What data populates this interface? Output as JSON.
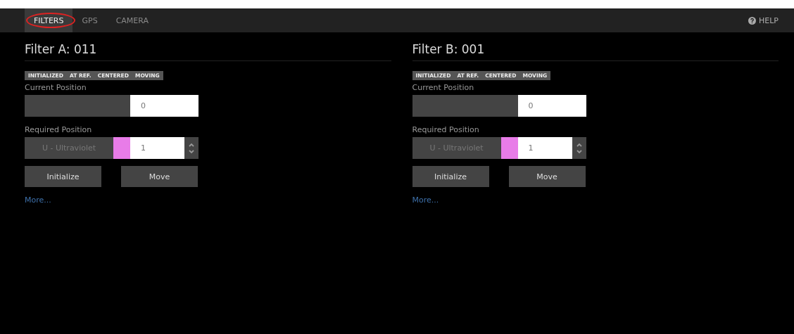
{
  "nav": {
    "tabs": [
      {
        "label": "FILTERS",
        "selected": true
      },
      {
        "label": "GPS",
        "selected": false
      },
      {
        "label": "CAMERA",
        "selected": false
      }
    ],
    "help": "HELP"
  },
  "filters": [
    {
      "title": "Filter A: 011",
      "statuses": [
        "INITIALIZED",
        "AT REF.",
        "CENTERED",
        "MOVING"
      ],
      "current_label": "Current Position",
      "current_value": "0",
      "required_label": "Required Position",
      "filter_name": "U - Ultraviolet",
      "color": "#e87ce8",
      "required_value": "1",
      "buttons": [
        "Initialize",
        "Move"
      ],
      "more": "More..."
    },
    {
      "title": "Filter B: 001",
      "statuses": [
        "INITIALIZED",
        "AT REF.",
        "CENTERED",
        "MOVING"
      ],
      "current_label": "Current Position",
      "current_value": "0",
      "required_label": "Required Position",
      "filter_name": "U - Ultraviolet",
      "color": "#e87ce8",
      "required_value": "1",
      "buttons": [
        "Initialize",
        "Move"
      ],
      "more": "More..."
    }
  ]
}
